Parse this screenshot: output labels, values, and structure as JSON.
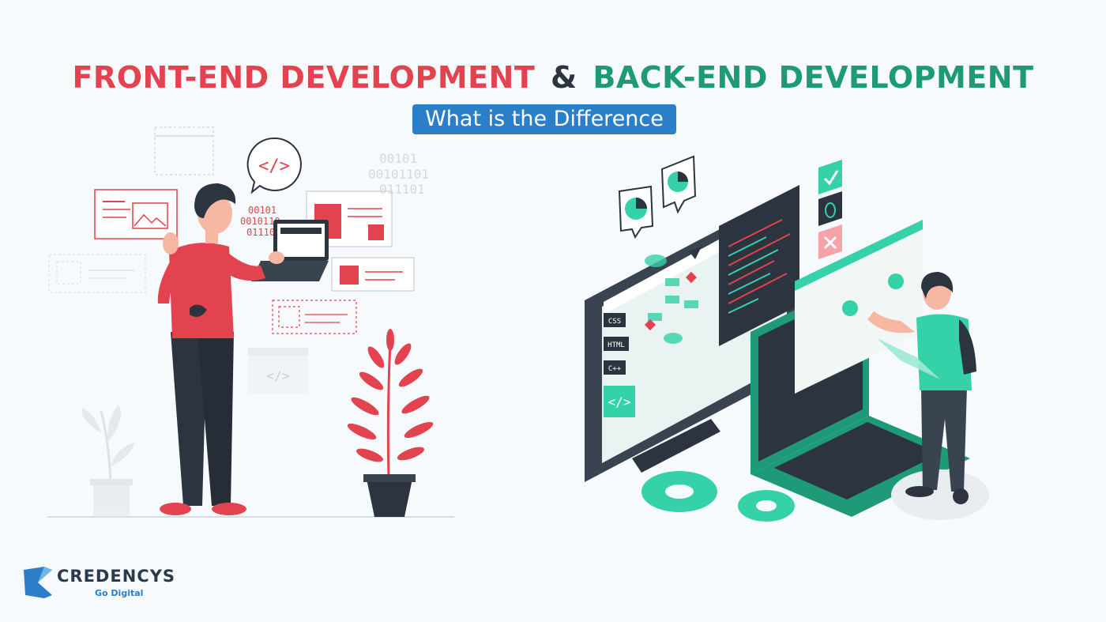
{
  "header": {
    "front_label": "FRONT-END DEVELOPMENT",
    "amp": "&",
    "back_label": "BACK-END DEVELOPMENT",
    "subtitle": "What is the Difference"
  },
  "front_illustration": {
    "binary_lines": [
      "00101",
      "0010110",
      "01110"
    ],
    "code_tag": "</>"
  },
  "back_illustration": {
    "binary_lines": [
      "00101",
      "00101101",
      "011101"
    ],
    "labels": [
      "CSS",
      "HTML",
      "C++"
    ],
    "code_tag": "</>"
  },
  "brand": {
    "name": "CREDENCYS",
    "tagline": "Go Digital"
  },
  "colors": {
    "front_red": "#e2434f",
    "back_green": "#1f9a78",
    "accent_teal": "#35d1a8",
    "subtitle_blue": "#2a7fc8",
    "dark": "#2c3440"
  }
}
